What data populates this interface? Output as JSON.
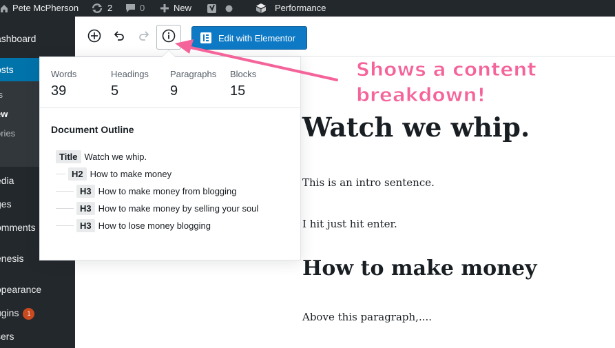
{
  "adminbar": {
    "user_name": "Pete McPherson",
    "updates_count": "2",
    "comments_count": "0",
    "new_label": "New",
    "performance_label": "Performance"
  },
  "sidebar": {
    "items": [
      {
        "label": "ashboard"
      },
      {
        "label": "osts"
      },
      {
        "label": "ts"
      },
      {
        "label": "ew"
      },
      {
        "label": "ories"
      },
      {
        "label": "edia"
      },
      {
        "label": "ges"
      },
      {
        "label": "omments"
      },
      {
        "label": "enesis"
      },
      {
        "label": "opearance"
      },
      {
        "label": "ugins"
      },
      {
        "label": "sers"
      }
    ],
    "plugins_badge": "1"
  },
  "toolbar": {
    "elementor_label": "Edit with Elementor"
  },
  "info_popover": {
    "stats": [
      {
        "label": "Words",
        "value": "39"
      },
      {
        "label": "Headings",
        "value": "5"
      },
      {
        "label": "Paragraphs",
        "value": "9"
      },
      {
        "label": "Blocks",
        "value": "15"
      }
    ],
    "outline_title": "Document Outline",
    "outline": [
      {
        "tag": "Title",
        "text": "Watch we whip."
      },
      {
        "tag": "H2",
        "text": "How to make money"
      },
      {
        "tag": "H3",
        "text": "How to make money from blogging"
      },
      {
        "tag": "H3",
        "text": "How to make money by selling your soul"
      },
      {
        "tag": "H3",
        "text": "How to lose money blogging"
      }
    ]
  },
  "content": {
    "title": "Watch we whip.",
    "para1": "This is an intro sentence.",
    "para2": "I hit just hit enter.",
    "heading2": "How to make money",
    "para3": "Above this paragraph,...."
  },
  "annotation": {
    "line1": "Shows a content",
    "line2": "breakdown!"
  },
  "colors": {
    "admin_bg": "#23282d",
    "accent_blue": "#0073aa",
    "elementor_blue": "#0e7ac6",
    "annotation_pink": "#f4649a",
    "badge_orange": "#ca4a1f"
  }
}
